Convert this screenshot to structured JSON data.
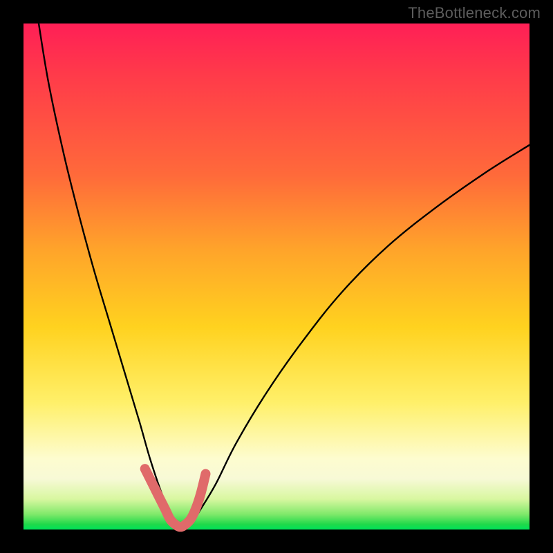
{
  "watermark": "TheBottleneck.com",
  "chart_data": {
    "type": "line",
    "title": "",
    "xlabel": "",
    "ylabel": "",
    "xlim": [
      0,
      100
    ],
    "ylim": [
      0,
      100
    ],
    "series": [
      {
        "name": "bottleneck-curve",
        "x": [
          3,
          5,
          8,
          11,
          14,
          17,
          20,
          23,
          25,
          27,
          29,
          30,
          31,
          33,
          35,
          38,
          42,
          48,
          55,
          63,
          72,
          82,
          92,
          100
        ],
        "y": [
          100,
          88,
          74,
          62,
          51,
          41,
          31,
          21,
          14,
          8,
          3,
          1,
          0.5,
          1,
          4,
          9,
          17,
          27,
          37,
          47,
          56,
          64,
          71,
          76
        ]
      },
      {
        "name": "highlight-zone",
        "x": [
          24,
          26,
          28,
          29,
          30,
          31,
          32,
          33,
          34,
          35,
          36
        ],
        "y": [
          12,
          8,
          4,
          2,
          1,
          0.5,
          1,
          2,
          4,
          7,
          11
        ]
      }
    ],
    "colors": {
      "curve": "#000000",
      "highlight": "#e06a6a",
      "gradient_top": "#ff1f56",
      "gradient_bottom": "#00e35a"
    }
  }
}
